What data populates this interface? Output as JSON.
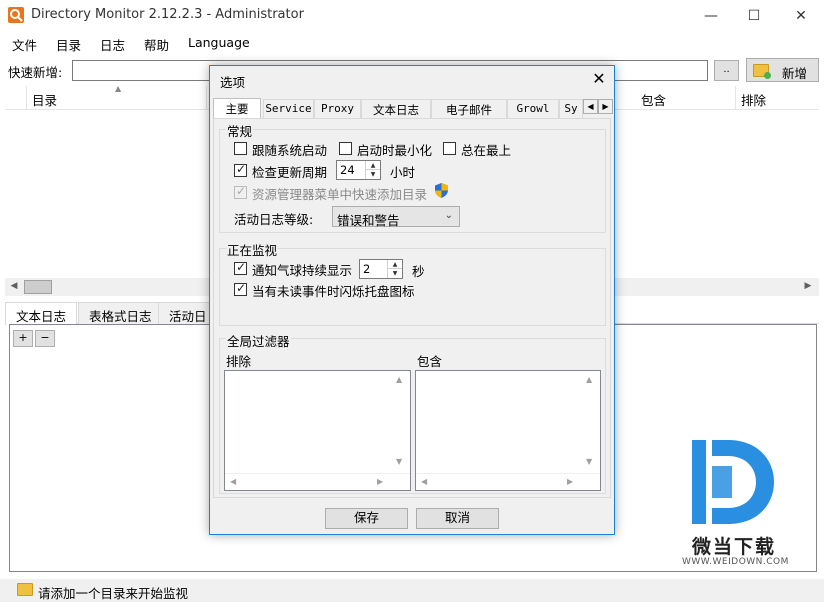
{
  "window": {
    "title": "Directory Monitor 2.12.2.3 - Administrator",
    "minimize_glyph": "—",
    "maximize_glyph": "☐",
    "close_glyph": "✕"
  },
  "menu": {
    "items": [
      "文件",
      "目录",
      "日志",
      "帮助",
      "Language"
    ]
  },
  "quick_add": {
    "label": "快速新增:",
    "value": "",
    "browse_label": "..",
    "add_button_label": "新增"
  },
  "grid": {
    "columns": [
      "目录",
      "包含",
      "排除"
    ]
  },
  "log_tabs": {
    "tabs": [
      "文本日志",
      "表格式日志",
      "活动日"
    ],
    "plus_label": "+",
    "minus_label": "−"
  },
  "status": {
    "text": "请添加一个目录来开始监视"
  },
  "watermark": {
    "cn": "微当下载",
    "url": "WWW.WEIDOWN.COM"
  },
  "dialog": {
    "title": "选项",
    "close_glyph": "✕",
    "tabs": [
      "主要",
      "Service",
      "Proxy",
      "文本日志",
      "电子邮件",
      "Growl",
      "Sy"
    ],
    "active_tab": "主要",
    "general": {
      "label": "常规",
      "start_with_system": {
        "label": "跟随系统启动",
        "checked": false
      },
      "start_minimized": {
        "label": "启动时最小化",
        "checked": false
      },
      "always_on_top": {
        "label": "总在最上",
        "checked": false
      },
      "check_updates": {
        "label": "检查更新周期",
        "checked": true,
        "value": "24",
        "unit": "小时"
      },
      "explorer_menu": {
        "label": "资源管理器菜单中快速添加目录",
        "checked": true,
        "disabled": true
      },
      "log_level": {
        "label": "活动日志等级:",
        "value": "错误和警告"
      }
    },
    "monitoring": {
      "label": "正在监视",
      "balloon": {
        "label": "通知气球持续显示",
        "checked": true,
        "value": "2",
        "unit": "秒"
      },
      "flash_tray": {
        "label": "当有未读事件时闪烁托盘图标",
        "checked": true
      }
    },
    "global_filter": {
      "label": "全局过滤器",
      "exclude_label": "排除",
      "include_label": "包含"
    },
    "buttons": {
      "save": "保存",
      "cancel": "取消"
    }
  }
}
